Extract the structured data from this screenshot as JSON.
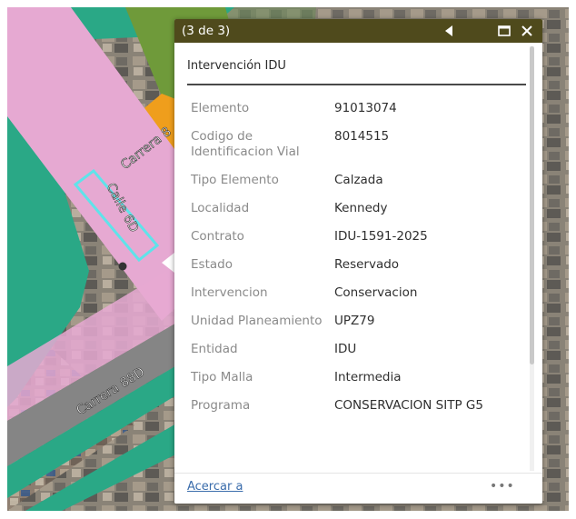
{
  "map": {
    "street_labels": [
      "Carrera 8",
      "Calle 6D",
      "Carrera 88D"
    ]
  },
  "popup": {
    "counter": "(3 de 3)",
    "title": "Intervención IDU",
    "attributes": [
      {
        "label": "Elemento",
        "value": "91013074"
      },
      {
        "label": "Codigo de Identificacion Vial",
        "value": "8014515"
      },
      {
        "label": "Tipo Elemento",
        "value": "Calzada"
      },
      {
        "label": "Localidad",
        "value": "Kennedy"
      },
      {
        "label": "Contrato",
        "value": "IDU-1591-2025"
      },
      {
        "label": "Estado",
        "value": "Reservado"
      },
      {
        "label": "Intervencion",
        "value": "Conservacion"
      },
      {
        "label": "Unidad Planeamiento",
        "value": "UPZ79"
      },
      {
        "label": "Entidad",
        "value": "IDU"
      },
      {
        "label": "Tipo Malla",
        "value": "Intermedia"
      },
      {
        "label": "Programa",
        "value": "CONSERVACION SITP G5"
      }
    ],
    "footer_link": "Acercar a",
    "menu_label": "•••"
  },
  "colors": {
    "header_bg": "#4f4a1c",
    "highlight_pink": "#e6a9d2",
    "highlight_teal": "#2aa886",
    "highlight_orange": "#ef9e1c",
    "selection_cyan": "#5fe3ea"
  },
  "icons": {
    "prev": "triangle-left-icon",
    "maximize": "square-icon",
    "close": "x-icon"
  }
}
